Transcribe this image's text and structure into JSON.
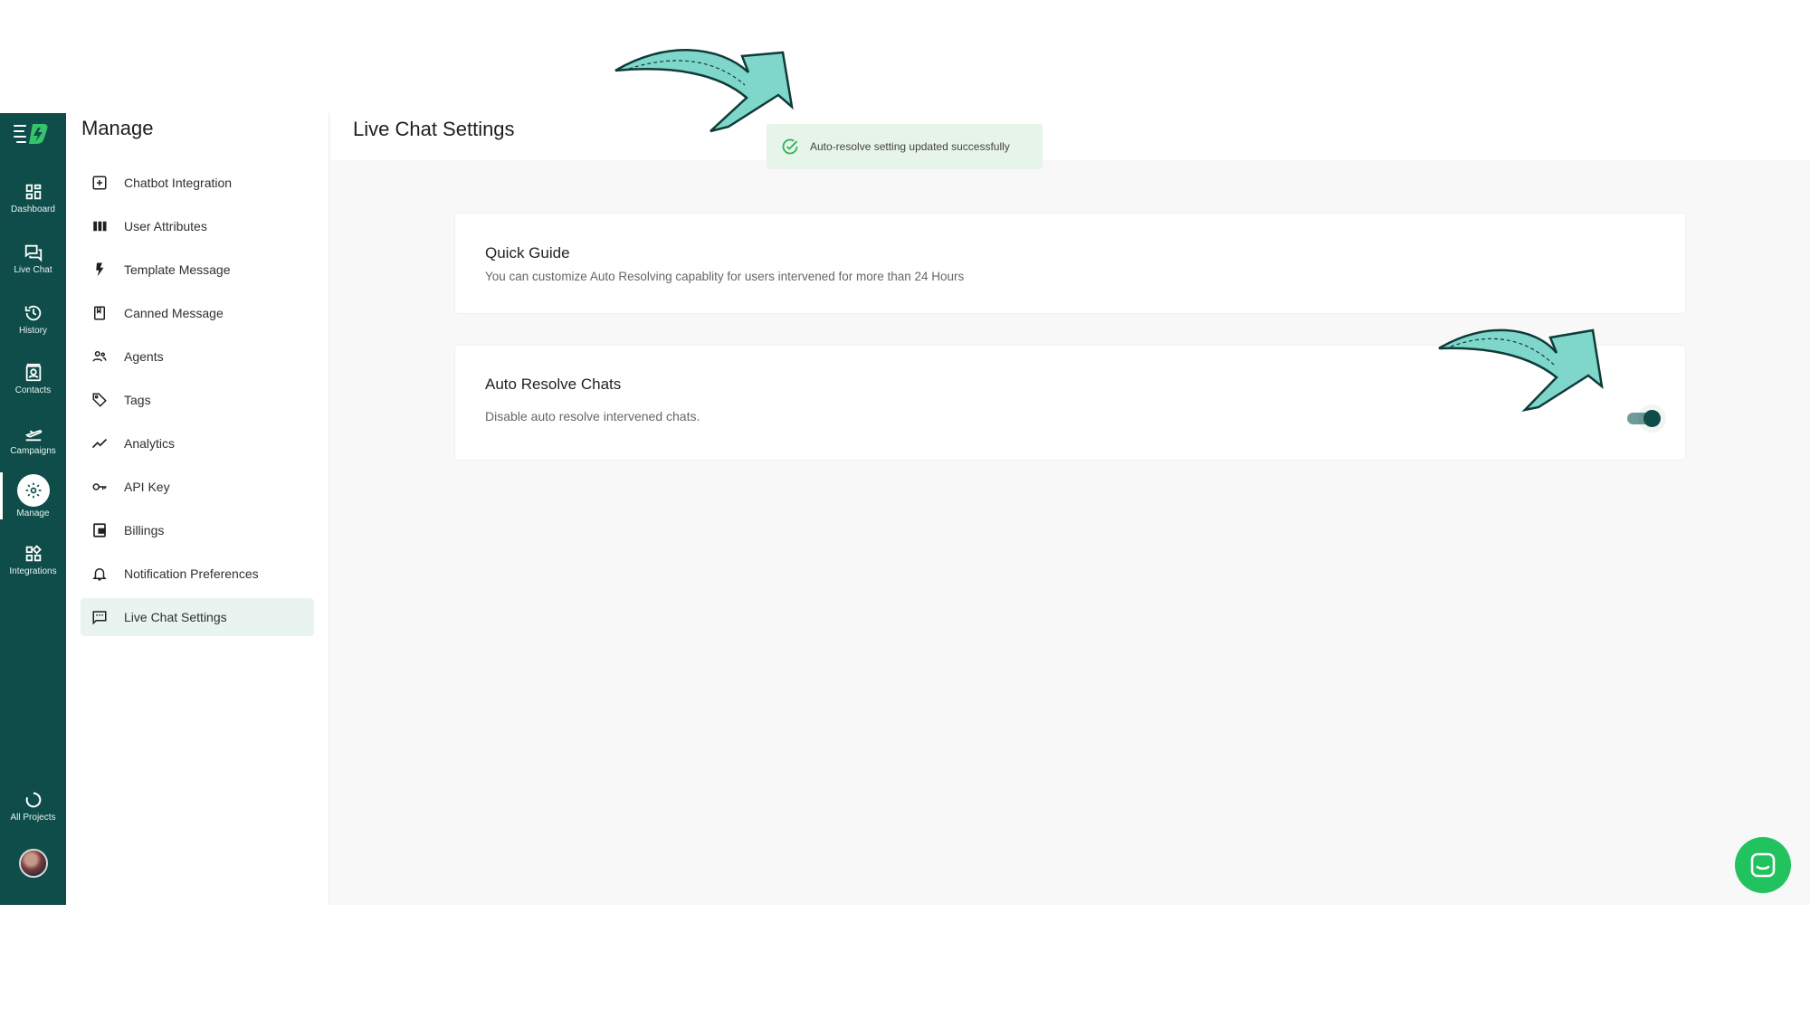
{
  "rail": {
    "items": [
      {
        "label": "Dashboard",
        "icon": "dashboard-icon"
      },
      {
        "label": "Live Chat",
        "icon": "chat-icon"
      },
      {
        "label": "History",
        "icon": "history-icon"
      },
      {
        "label": "Contacts",
        "icon": "contacts-icon"
      },
      {
        "label": "Campaigns",
        "icon": "campaigns-icon"
      },
      {
        "label": "Manage",
        "icon": "gear-icon"
      },
      {
        "label": "Integrations",
        "icon": "integrations-icon"
      },
      {
        "label": "All Projects",
        "icon": "projects-icon"
      }
    ],
    "active": "Manage"
  },
  "manage": {
    "title": "Manage",
    "items": [
      {
        "label": "Chatbot Integration",
        "icon": "plus-box-icon"
      },
      {
        "label": "User Attributes",
        "icon": "columns-icon"
      },
      {
        "label": "Template Message",
        "icon": "bolt-icon"
      },
      {
        "label": "Canned Message",
        "icon": "book-icon"
      },
      {
        "label": "Agents",
        "icon": "people-icon"
      },
      {
        "label": "Tags",
        "icon": "tag-icon"
      },
      {
        "label": "Analytics",
        "icon": "trend-icon"
      },
      {
        "label": "API Key",
        "icon": "key-icon"
      },
      {
        "label": "Billings",
        "icon": "wallet-icon"
      },
      {
        "label": "Notification Preferences",
        "icon": "bell-icon"
      },
      {
        "label": "Live Chat Settings",
        "icon": "message-icon"
      }
    ],
    "active": "Live Chat Settings"
  },
  "main": {
    "title": "Live Chat Settings",
    "toast": "Auto-resolve setting updated successfully",
    "quick_guide": {
      "title": "Quick Guide",
      "description": "You can customize Auto Resolving capablity for users intervened for more than 24 Hours"
    },
    "auto_resolve": {
      "title": "Auto Resolve Chats",
      "description": "Disable auto resolve intervened chats.",
      "enabled": true
    }
  },
  "colors": {
    "rail_bg": "#0e4d4a",
    "active_menu_bg": "#e9f4f1",
    "toast_bg": "#e6f4ea",
    "toast_icon": "#2fb35a",
    "toggle_on": "#0e4d4a",
    "chat_fab": "#22c35e",
    "arrow": "#7fd6cb"
  }
}
